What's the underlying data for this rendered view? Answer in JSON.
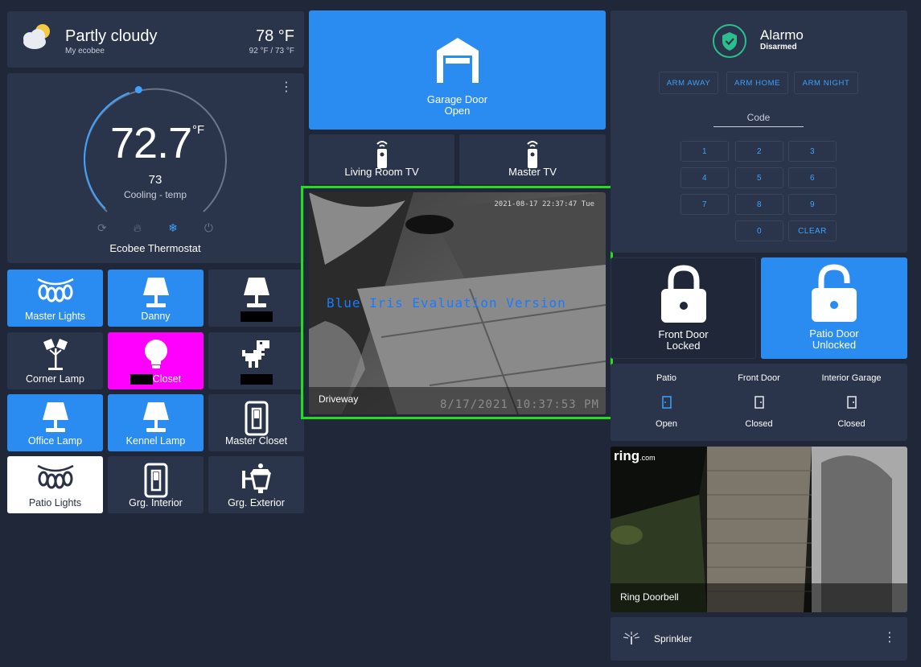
{
  "weather": {
    "condition": "Partly cloudy",
    "source": "My ecobee",
    "temperature": "78 °F",
    "high_low": "92 °F / 73 °F",
    "icon": "partly-cloudy-icon"
  },
  "thermostat": {
    "current": "72.7",
    "unit": "°F",
    "target": "73",
    "mode": "Cooling - temp",
    "name": "Ecobee Thermostat",
    "modes": [
      "auto-icon",
      "heat-icon",
      "cool-icon",
      "power-icon"
    ],
    "active_mode": "cool-icon",
    "dial_fraction": 0.42
  },
  "tiles": [
    {
      "label": "Master Lights",
      "state": "on",
      "icon": "string-lights-icon"
    },
    {
      "label": "Danny",
      "state": "on",
      "icon": "lamp-icon"
    },
    {
      "label": "",
      "state": "off",
      "icon": "lamp-icon",
      "redacted": true
    },
    {
      "label": "Corner Lamp",
      "state": "off",
      "icon": "floor-lamp-icon"
    },
    {
      "label": "Closet",
      "state": "color",
      "icon": "bulb-icon",
      "redacted_prefix": true
    },
    {
      "label": "",
      "state": "off",
      "icon": "dino-icon",
      "redacted": true
    },
    {
      "label": "Office Lamp",
      "state": "on",
      "icon": "lamp-icon"
    },
    {
      "label": "Kennel Lamp",
      "state": "on",
      "icon": "lamp-icon"
    },
    {
      "label": "Master Closet",
      "state": "off",
      "icon": "switch-icon"
    },
    {
      "label": "Patio Lights",
      "state": "white",
      "icon": "string-lights-icon"
    },
    {
      "label": "Grg. Interior",
      "state": "off",
      "icon": "switch-icon"
    },
    {
      "label": "Grg. Exterior",
      "state": "off",
      "icon": "wall-lantern-icon"
    }
  ],
  "garage": {
    "name": "Garage Door",
    "state": "Open",
    "icon": "garage-icon"
  },
  "remotes": [
    {
      "label": "Living Room TV",
      "icon": "remote-icon"
    },
    {
      "label": "Master TV",
      "icon": "remote-icon"
    }
  ],
  "camera": {
    "name": "Driveway",
    "timestamp": "2021-08-17 22:37:47 Tue",
    "watermark": "Blue Iris Evaluation Version",
    "overlay_time": "8/17/2021 10:37:53 PM"
  },
  "alarm": {
    "title": "Alarmo",
    "state": "Disarmed",
    "arm_buttons": [
      "ARM AWAY",
      "ARM HOME",
      "ARM NIGHT"
    ],
    "code_label": "Code",
    "keys": [
      "1",
      "2",
      "3",
      "4",
      "5",
      "6",
      "7",
      "8",
      "9",
      "0",
      "CLEAR"
    ]
  },
  "locks": [
    {
      "name": "Front Door",
      "state": "Locked",
      "icon": "lock-closed-icon"
    },
    {
      "name": "Patio Door",
      "state": "Unlocked",
      "icon": "lock-open-icon"
    }
  ],
  "doors": [
    {
      "name": "Patio",
      "state": "Open",
      "icon": "door-open-icon"
    },
    {
      "name": "Front Door",
      "state": "Closed",
      "icon": "door-closed-icon"
    },
    {
      "name": "Interior Garage",
      "state": "Closed",
      "icon": "door-closed-icon"
    }
  ],
  "ring": {
    "name": "Ring Doorbell",
    "logo": "ring",
    "logo_suffix": ".com"
  },
  "sprinkler": {
    "name": "Sprinkler",
    "icon": "sprinkler-icon"
  },
  "colors": {
    "accent": "#2a8cf0",
    "card": "#2a344a",
    "background": "#1f2739",
    "highlight": "#22dd22"
  }
}
